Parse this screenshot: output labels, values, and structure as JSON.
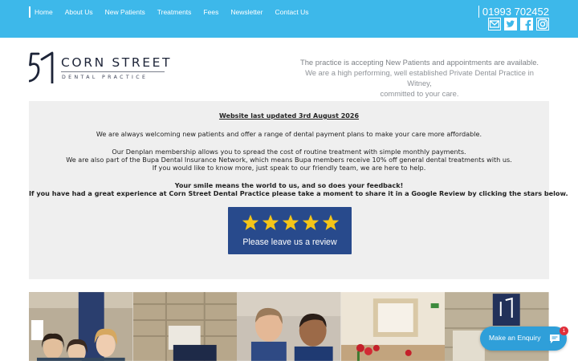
{
  "nav": {
    "items": [
      {
        "label": "Home"
      },
      {
        "label": "About Us"
      },
      {
        "label": "New Patients"
      },
      {
        "label": "Treatments"
      },
      {
        "label": "Fees"
      },
      {
        "label": "Newsletter"
      },
      {
        "label": "Contact Us"
      }
    ]
  },
  "header": {
    "phone": "01993 702452",
    "social": [
      "email-icon",
      "twitter-icon",
      "facebook-icon",
      "instagram-icon"
    ]
  },
  "logo": {
    "name": "CORN STREET",
    "subtitle": "DENTAL PRACTICE"
  },
  "tagline": {
    "line1": "The practice is accepting New Patients and appointments are available.",
    "line2": "We are a high performing, well established Private Dental Practice in Witney,",
    "line3": "committed to your care."
  },
  "notice": {
    "updated": "Website last updated 3rd August 2026",
    "welcome": "We are always welcoming new patients and offer a range of dental payment plans to make your care more affordable.",
    "denplan": "Our Denplan membership allows you to spread the cost of routine treatment with simple monthly payments.",
    "bupa": "We are also part of the Bupa Dental Insurance Network, which means Bupa members receive 10% off general dental treatments with us.",
    "more": "If you would like to know more, just speak to our friendly team, we are here to help.",
    "smile": "Your smile means the world to us, and so does your feedback!",
    "review_ask": "If you have had a great experience at Corn Street Dental Practice please take a moment to share it in a Google Review by clicking the stars below."
  },
  "review_button": {
    "label": "Please leave us a review",
    "stars": 5
  },
  "enquiry": {
    "label": "Make an Enquiry",
    "badge": "1"
  },
  "colors": {
    "topbar": "#3db8ea",
    "review_button": "#284a8c",
    "star": "#f5c518",
    "enquiry": "#2f9fd9",
    "badge": "#e02f3a"
  }
}
